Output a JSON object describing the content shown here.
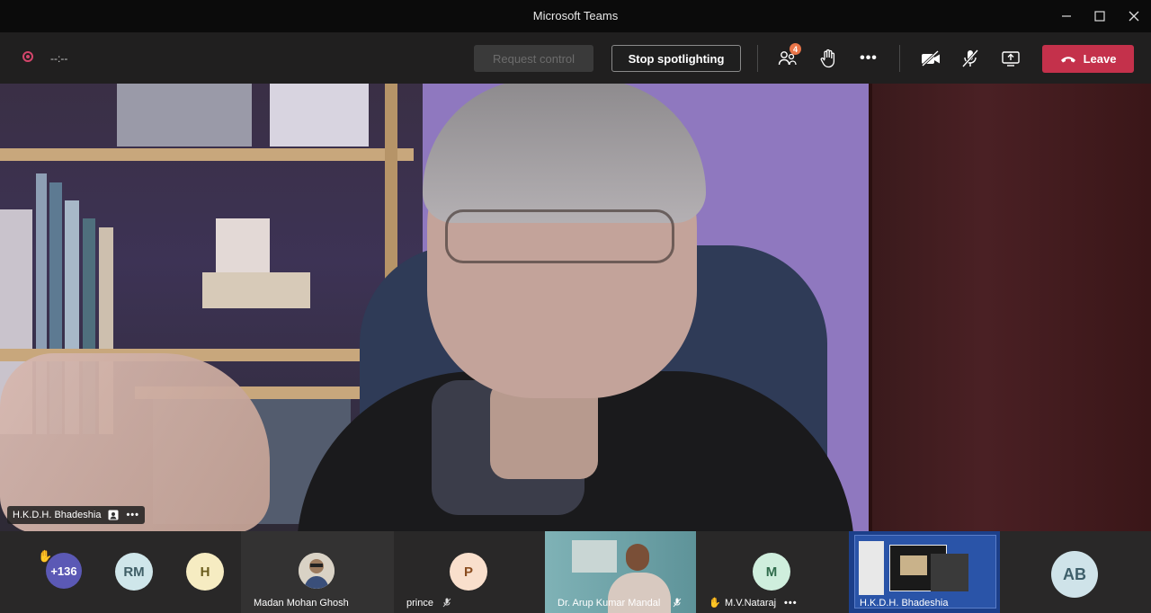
{
  "window": {
    "title": "Microsoft Teams"
  },
  "toolbar": {
    "timer": "--:--",
    "request_control_label": "Request control",
    "stop_spotlighting_label": "Stop spotlighting",
    "participants_count": "4",
    "more_label": "•••",
    "leave_label": "Leave"
  },
  "stage": {
    "presenter_name": "H.K.D.H. Bhadeshia",
    "more_label": "•••"
  },
  "strip": {
    "overflow_count": "+136",
    "tiles": [
      {
        "initials": "RM",
        "color": "#cfe6ea"
      },
      {
        "initials": "H",
        "color": "#f6ecc2"
      },
      {
        "name": "Madan Mohan Ghosh"
      },
      {
        "initials": "P",
        "name": "prince",
        "color": "#f9dfcc"
      },
      {
        "name": "Dr. Arup Kumar Mandal"
      },
      {
        "initials": "M",
        "name": "M.V.Nataraj",
        "more_label": "•••",
        "color": "#cfeedd"
      },
      {
        "name": "H.K.D.H. Bhadeshia"
      },
      {
        "initials": "AB",
        "color": "#cfe3e9"
      }
    ]
  },
  "colors": {
    "leave": "#c4314b",
    "record": "#d4456b",
    "badge": "#e97548",
    "overflow_avatar": "#5b59b5"
  }
}
